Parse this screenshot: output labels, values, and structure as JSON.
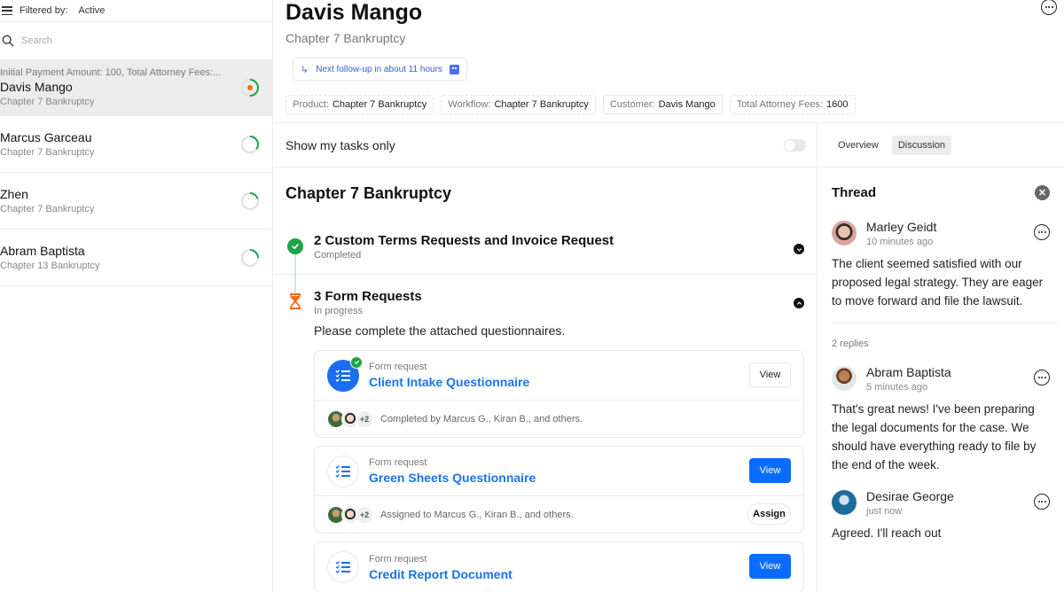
{
  "sidebar": {
    "filter_label": "Filtered by:",
    "filter_value": "Active",
    "search_placeholder": "Search",
    "cases": [
      {
        "meta": "Initial Payment Amount: 100, Total Attorney Fees:...",
        "name": "Davis Mango",
        "product": "Chapter 7 Bankruptcy",
        "progress": 0.5,
        "active": true
      },
      {
        "meta": "",
        "name": "Marcus Garceau",
        "product": "Chapter 7 Bankruptcy",
        "progress": 0.35,
        "active": false
      },
      {
        "meta": "",
        "name": "Zhen",
        "product": "Chapter 7 Bankruptcy",
        "progress": 0.2,
        "active": false
      },
      {
        "meta": "",
        "name": "Abram Baptista",
        "product": "Chapter 13 Bankruptcy",
        "progress": 0.25,
        "active": false
      }
    ]
  },
  "header": {
    "title": "Davis Mango",
    "subtitle": "Chapter 7 Bankruptcy",
    "followup": "Next follow-up in about 11 hours",
    "chips": [
      {
        "key": "Product:",
        "value": "Chapter 7 Bankruptcy"
      },
      {
        "key": "Workflow:",
        "value": "Chapter 7 Bankruptcy"
      },
      {
        "key": "Customer:",
        "value": "Davis Mango"
      },
      {
        "key": "Total Attorney Fees:",
        "value": "1600"
      }
    ]
  },
  "tasks": {
    "filter_label": "Show my tasks only",
    "show_my_tasks_only": false,
    "workflow_title": "Chapter 7 Bankruptcy",
    "steps": [
      {
        "title": "2 Custom Terms Requests and Invoice Request",
        "status": "Completed"
      },
      {
        "title": "3 Form Requests",
        "status": "In progress",
        "description": "Please complete the attached questionnaires."
      }
    ],
    "forms": [
      {
        "kind": "Form request",
        "title": "Client Intake Questionnaire",
        "view_label": "View",
        "footer": "Completed by Marcus G., Kiran B., and others.",
        "extra_count": "+2"
      },
      {
        "kind": "Form request",
        "title": "Green Sheets Questionnaire",
        "view_label": "View",
        "footer": "Assigned to Marcus G., Kiran B., and others.",
        "extra_count": "+2",
        "assign_label": "Assign"
      },
      {
        "kind": "Form request",
        "title": "Credit Report Document",
        "view_label": "View"
      }
    ]
  },
  "panel": {
    "tabs": [
      "Overview",
      "Discussion"
    ],
    "active_tab": "Discussion",
    "thread_title": "Thread",
    "replies_label": "2 replies",
    "comments": [
      {
        "name": "Marley Geidt",
        "time": "10 minutes ago",
        "body": "The client seemed satisfied with our proposed legal strategy. They are eager to move forward and file the lawsuit."
      },
      {
        "name": "Abram Baptista",
        "time": "5 minutes ago",
        "body": "That's great news! I've been preparing the legal documents for the case. We should have everything ready to file by the end of the week."
      },
      {
        "name": "Desirae George",
        "time": "just now",
        "body": "Agreed. I'll reach out"
      }
    ]
  },
  "colors": {
    "accent_blue": "#0a6cff",
    "link_blue": "#1a73e8",
    "success_green": "#1fa34a",
    "progress_orange": "#f26b1d"
  }
}
